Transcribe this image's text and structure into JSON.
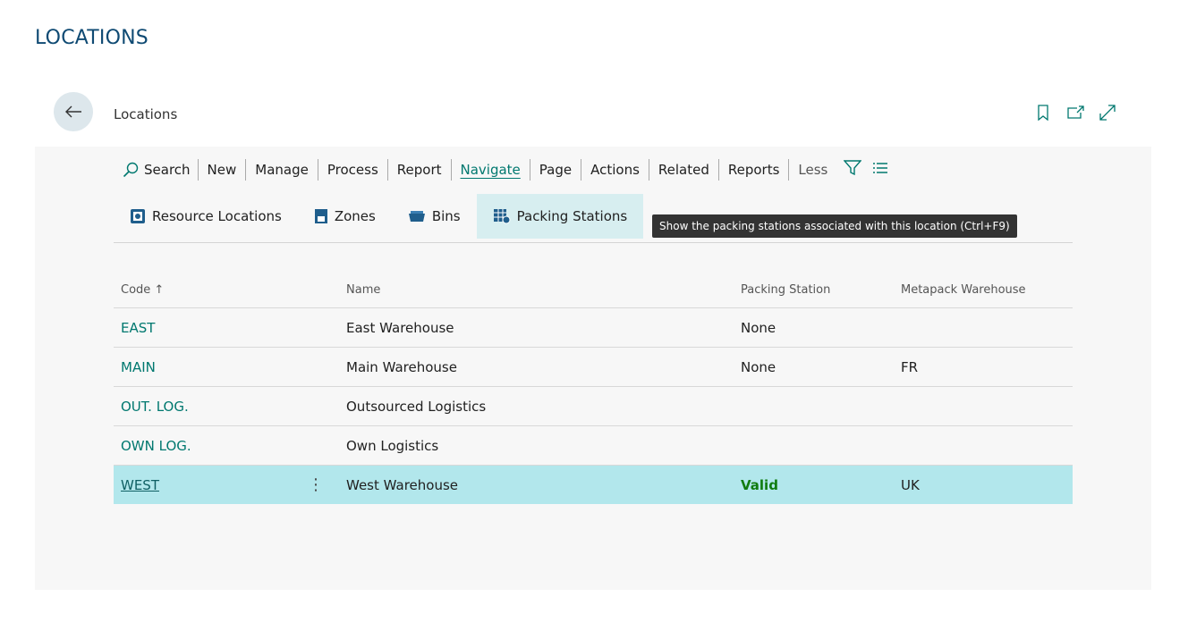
{
  "page": {
    "heading": "LOCATIONS"
  },
  "header": {
    "title": "Locations"
  },
  "action_bar": {
    "search": "Search",
    "new": "New",
    "manage": "Manage",
    "process": "Process",
    "report": "Report",
    "navigate": "Navigate",
    "page": "Page",
    "actions": "Actions",
    "related": "Related",
    "reports": "Reports",
    "less": "Less"
  },
  "sub_actions": {
    "resource_locations": "Resource Locations",
    "zones": "Zones",
    "bins": "Bins",
    "packing_stations": "Packing Stations"
  },
  "tooltip": "Show the packing stations associated with this location (Ctrl+F9)",
  "grid": {
    "headers": {
      "code": "Code",
      "sort_indicator": "↑",
      "name": "Name",
      "packing_station": "Packing Station",
      "metapack_warehouse": "Metapack Warehouse"
    },
    "rows": [
      {
        "code": "EAST",
        "name": "East Warehouse",
        "packing_station": "None",
        "metapack_warehouse": ""
      },
      {
        "code": "MAIN",
        "name": "Main Warehouse",
        "packing_station": "None",
        "metapack_warehouse": "FR"
      },
      {
        "code": "OUT. LOG.",
        "name": "Outsourced Logistics",
        "packing_station": "",
        "metapack_warehouse": ""
      },
      {
        "code": "OWN LOG.",
        "name": "Own Logistics",
        "packing_station": "",
        "metapack_warehouse": ""
      },
      {
        "code": "WEST",
        "name": "West Warehouse",
        "packing_station": "Valid",
        "metapack_warehouse": "UK",
        "menu": "⋮"
      }
    ]
  },
  "colors": {
    "heading": "#0f4a73",
    "accent": "#00786f",
    "selected_row": "#b2e7ec",
    "valid": "#107c10"
  }
}
